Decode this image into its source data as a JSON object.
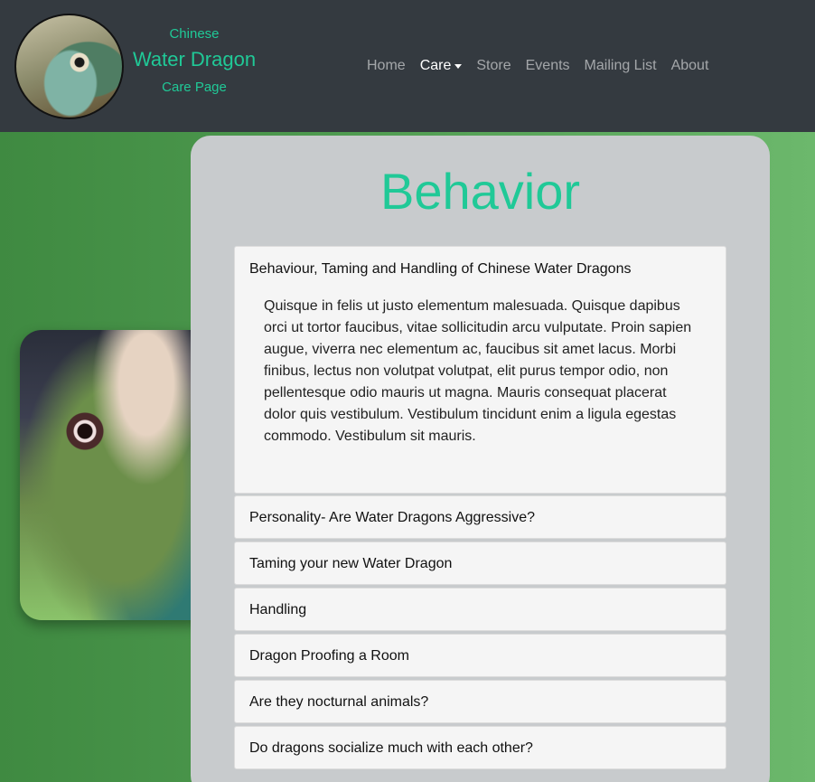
{
  "brand": {
    "line1": "Chinese",
    "line2": "Water Dragon",
    "line3": "Care Page"
  },
  "nav": {
    "items": [
      {
        "label": "Home",
        "active": false
      },
      {
        "label": "Care",
        "active": true,
        "dropdown": true
      },
      {
        "label": "Store",
        "active": false
      },
      {
        "label": "Events",
        "active": false
      },
      {
        "label": "Mailing List",
        "active": false
      },
      {
        "label": "About",
        "active": false
      }
    ]
  },
  "page": {
    "title": "Behavior"
  },
  "accordion": {
    "open": {
      "header": "Behaviour, Taming and Handling of Chinese Water Dragons",
      "body": "Quisque in felis ut justo elementum malesuada. Quisque dapibus orci ut tortor faucibus, vitae sollicitudin arcu vulputate. Proin sapien augue, viverra nec elementum ac, faucibus sit amet lacus. Morbi finibus, lectus non volutpat volutpat, elit purus tempor odio, non pellentesque odio mauris ut magna. Mauris consequat placerat dolor quis vestibulum. Vestibulum tincidunt enim a ligula egestas commodo. Vestibulum sit mauris."
    },
    "items": [
      "Personality- Are Water Dragons Aggressive?",
      "Taming your new Water Dragon",
      "Handling",
      "Dragon Proofing a Room",
      "Are they nocturnal animals?",
      "Do dragons socialize much with each other?"
    ]
  },
  "colors": {
    "accent": "#20c997",
    "navbar": "#343a40",
    "card": "#c8cbcd"
  }
}
